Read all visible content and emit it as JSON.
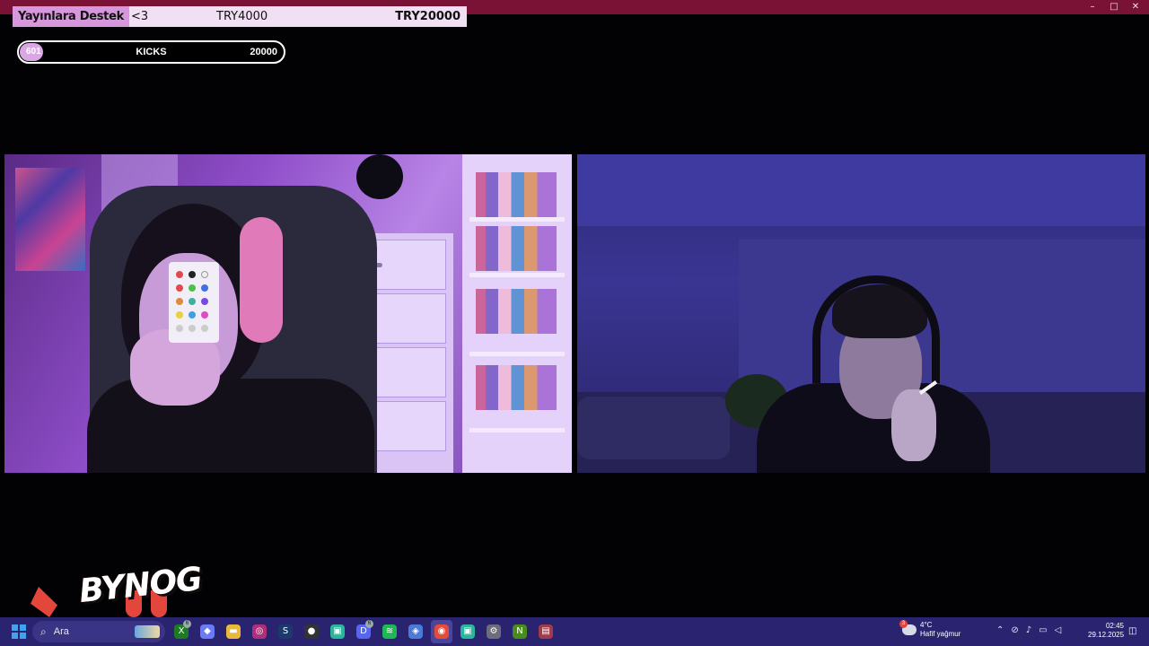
{
  "window": {
    "controls": [
      "–",
      "□",
      "✕"
    ],
    "title_bar_color": "#7a1236"
  },
  "donation_goal": {
    "label": "Yayınlara Destek",
    "heart": "<3",
    "current": "TRY4000",
    "goal": "TRY20000",
    "progress_fraction": 0.2
  },
  "kicks_goal": {
    "count": "601",
    "name": "KICKS",
    "target": "20000",
    "progress_fraction": 0.03
  },
  "logo": {
    "text": "BYNOG",
    "accent_color": "#e3463a"
  },
  "taskbar": {
    "search_placeholder": "Ara",
    "apps": [
      {
        "name": "xbox-icon",
        "glyph": "X",
        "color": "#1f7a24",
        "badge": "6"
      },
      {
        "name": "copilot-icon",
        "glyph": "◆",
        "color": "#6b7bf5"
      },
      {
        "name": "folder-icon",
        "glyph": "▬",
        "color": "#e8b93a"
      },
      {
        "name": "app-circle-icon",
        "glyph": "◎",
        "color": "#b02f7a"
      },
      {
        "name": "steam-icon",
        "glyph": "S",
        "color": "#1b3a6b"
      },
      {
        "name": "obs-icon",
        "glyph": "●",
        "color": "#333"
      },
      {
        "name": "app-green-icon",
        "glyph": "▣",
        "color": "#2bb59a"
      },
      {
        "name": "discord-icon",
        "glyph": "D",
        "color": "#5865f2",
        "badge": "6"
      },
      {
        "name": "spotify-icon",
        "glyph": "≋",
        "color": "#1db954"
      },
      {
        "name": "app-blue-icon",
        "glyph": "◈",
        "color": "#4b7bd6"
      },
      {
        "name": "chrome-icon",
        "glyph": "◉",
        "color": "#e34b3b",
        "active": true
      },
      {
        "name": "app-teal-icon",
        "glyph": "▣",
        "color": "#2bb59a"
      },
      {
        "name": "settings-icon",
        "glyph": "⚙",
        "color": "#6c6c7a"
      },
      {
        "name": "nvidia-icon",
        "glyph": "N",
        "color": "#4a8c1c"
      },
      {
        "name": "winrar-icon",
        "glyph": "▤",
        "color": "#a33a4a"
      }
    ],
    "weather": {
      "temp": "4°C",
      "desc": "Hafif yağmur",
      "badge": "3"
    },
    "clock": {
      "time": "02:45",
      "date": "29.12.2025"
    }
  }
}
